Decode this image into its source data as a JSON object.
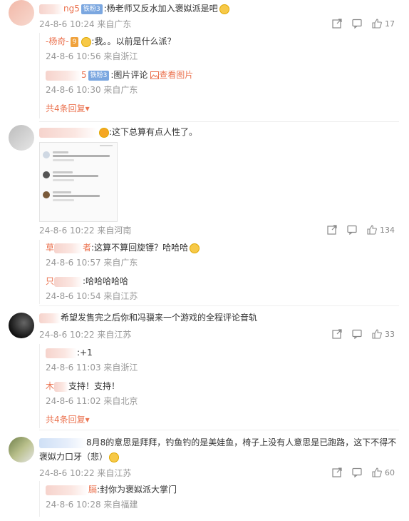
{
  "comments": [
    {
      "user": "ng5",
      "badge": "铁粉3",
      "text": ":杨老师又反水加入褒姒派是吧",
      "time": "24-8-6 10:24 来自广东",
      "likes": "17",
      "replies": [
        {
          "user": "-杨奇-",
          "badge": "9",
          "text": ":我。。以前是什么派？",
          "time": "24-8-6 10:56 来自浙江"
        },
        {
          "user": "5",
          "badge": "铁粉3",
          "text": ":图片评论",
          "link": "查看图片",
          "time": "24-8-6 10:30 来自广东"
        }
      ],
      "more": "共4条回复"
    },
    {
      "user": "",
      "text": ":这下总算有点人性了。",
      "time": "24-8-6 10:22 来自河南",
      "likes": "134",
      "replies": [
        {
          "user": "草",
          "user_tail": "者",
          "text": ":这算不算回旋镖？哈哈哈",
          "time": "24-8-6 10:57 来自广东"
        },
        {
          "user": "只",
          "text": ":哈哈哈哈哈",
          "time": "24-8-6 10:54 来自江苏"
        }
      ]
    },
    {
      "user": "",
      "text": "希望发售完之后你和冯骥来一个游戏的全程评论音轨",
      "time": "24-8-6 10:22 来自江苏",
      "likes": "33",
      "replies": [
        {
          "user": "",
          "text": ":+1",
          "time": "24-8-6 11:03 来自浙江"
        },
        {
          "user": "木",
          "text": "支持！支持！",
          "time": "24-8-6 11:02 来自北京"
        }
      ],
      "more": "共4条回复"
    },
    {
      "user": "",
      "text": "8月8的意思是拜拜，钓鱼钓的是美娃鱼，椅子上没有人意思是已跑路，这下不得不",
      "text2": "褒姒力口牙（悲）",
      "time": "24-8-6 10:22 来自江苏",
      "likes": "60",
      "replies": [
        {
          "user": "",
          "user_tail": "膈",
          "text": ":封你为褒姒派大掌门",
          "time": "24-8-6 10:28 来自福建"
        }
      ]
    }
  ],
  "colors": {
    "accent": "#eb7350",
    "meta": "#999999",
    "badge": "#7ba7e0"
  },
  "icons": [
    "share-icon",
    "comment-icon",
    "like-icon",
    "chevron-down-icon"
  ]
}
